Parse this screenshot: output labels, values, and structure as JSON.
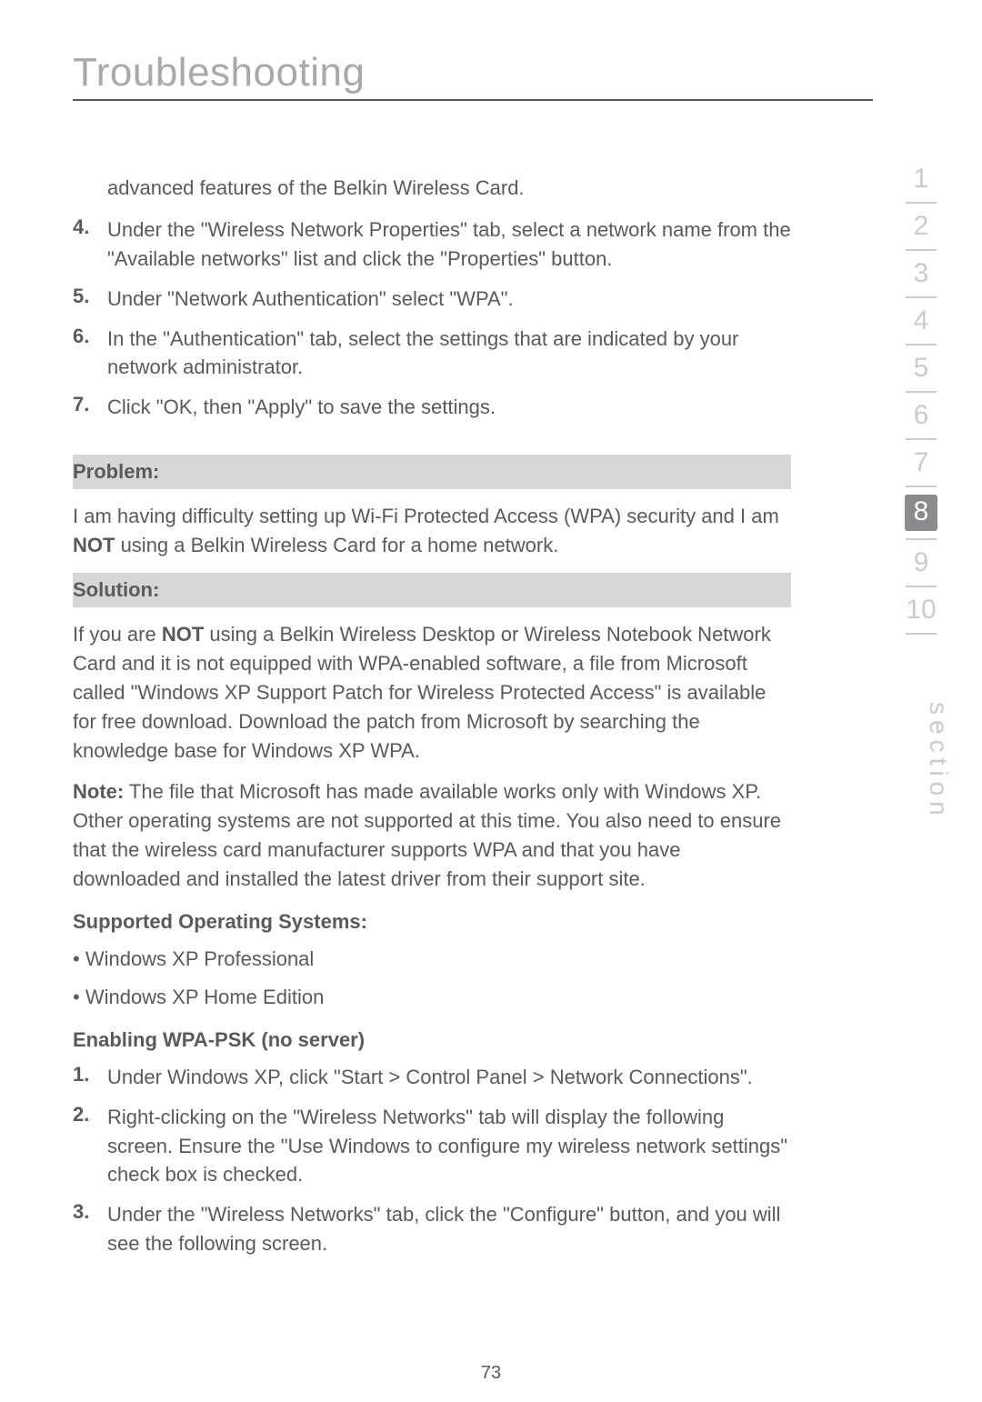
{
  "title": "Troubleshooting",
  "intro_continuation": "advanced features of the Belkin Wireless Card.",
  "top_steps": [
    {
      "n": "4.",
      "text": "Under the \"Wireless Network Properties\" tab, select a network name from the \"Available networks\" list and click the \"Properties\" button."
    },
    {
      "n": "5.",
      "text": "Under \"Network Authentication\" select \"WPA\"."
    },
    {
      "n": "6.",
      "text": "In the \"Authentication\" tab, select the settings that are indicated by your network administrator."
    },
    {
      "n": "7.",
      "text": "Click \"OK, then \"Apply\" to save the settings."
    }
  ],
  "problem_label": "Problem:",
  "problem_text_pre": "I am having difficulty setting up Wi-Fi Protected Access (WPA) security and I am ",
  "problem_text_bold": "NOT",
  "problem_text_post": " using a Belkin Wireless Card for a home network.",
  "solution_label": "Solution:",
  "solution_p1_pre": "If you are ",
  "solution_p1_bold": "NOT",
  "solution_p1_post": " using a Belkin Wireless Desktop or Wireless Notebook Network Card and it is not equipped with WPA-enabled software, a file from Microsoft called \"Windows XP Support Patch for Wireless Protected Access\" is available for free download. Download the patch from Microsoft by searching the knowledge base for Windows XP WPA.",
  "note_label": "Note:",
  "note_text": " The file that Microsoft has made available works only with Windows XP. Other operating systems are not supported at this time. You also need to ensure that the wireless card manufacturer supports WPA and that you have downloaded and installed the latest driver from their support site.",
  "supported_heading": "Supported Operating Systems:",
  "supported_items": [
    "• Windows XP Professional",
    "• Windows XP Home Edition"
  ],
  "enabling_heading": "Enabling WPA-PSK (no server)",
  "enabling_steps": [
    {
      "n": "1.",
      "text": "Under Windows XP, click \"Start > Control Panel > Network Connections\"."
    },
    {
      "n": "2.",
      "text": "Right-clicking on the \"Wireless Networks\" tab will display the following screen. Ensure the \"Use Windows to configure my wireless network settings\" check box is checked."
    },
    {
      "n": "3.",
      "text": "Under the \"Wireless Networks\" tab, click the \"Configure\" button, and you will see the following screen."
    }
  ],
  "sidebar": [
    "1",
    "2",
    "3",
    "4",
    "5",
    "6",
    "7",
    "8",
    "9",
    "10"
  ],
  "sidebar_active_index": 7,
  "section_label": "section",
  "page_number": "73"
}
